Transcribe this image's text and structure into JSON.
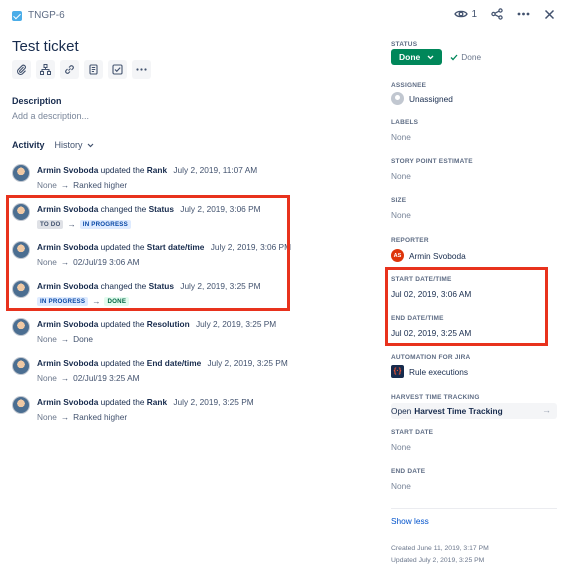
{
  "header": {
    "issue_key": "TNGP-6",
    "watch_count": "1",
    "icons": [
      "issue-type-icon",
      "eye-icon",
      "share-icon",
      "more-icon",
      "close-icon"
    ]
  },
  "issue": {
    "title": "Test ticket",
    "description_label": "Description",
    "description_placeholder": "Add a description..."
  },
  "activity": {
    "label": "Activity",
    "filter": "History",
    "entries": [
      {
        "user": "Armin Svoboda",
        "action": "updated the",
        "field": "Rank",
        "date": "July 2, 2019, 11:07 AM",
        "from": "None",
        "to": "Ranked higher"
      },
      {
        "user": "Armin Svoboda",
        "action": "changed the",
        "field": "Status",
        "date": "July 2, 2019, 3:06 PM",
        "from": "TO DO",
        "to": "IN PROGRESS"
      },
      {
        "user": "Armin Svoboda",
        "action": "updated the",
        "field": "Start date/time",
        "date": "July 2, 2019, 3:06 PM",
        "from": "None",
        "to": "02/Jul/19 3:06 AM"
      },
      {
        "user": "Armin Svoboda",
        "action": "changed the",
        "field": "Status",
        "date": "July 2, 2019, 3:25 PM",
        "from": "IN PROGRESS",
        "to": "DONE"
      },
      {
        "user": "Armin Svoboda",
        "action": "updated the",
        "field": "Resolution",
        "date": "July 2, 2019, 3:25 PM",
        "from": "None",
        "to": "Done"
      },
      {
        "user": "Armin Svoboda",
        "action": "updated the",
        "field": "End date/time",
        "date": "July 2, 2019, 3:25 PM",
        "from": "None",
        "to": "02/Jul/19 3:25 AM"
      },
      {
        "user": "Armin Svoboda",
        "action": "updated the",
        "field": "Rank",
        "date": "July 2, 2019, 3:25 PM",
        "from": "None",
        "to": "Ranked higher"
      }
    ]
  },
  "sidebar": {
    "status_label": "STATUS",
    "status_value": "Done",
    "status_done_text": "Done",
    "assignee_label": "ASSIGNEE",
    "assignee_value": "Unassigned",
    "labels_label": "LABELS",
    "labels_value": "None",
    "story_points_label": "STORY POINT ESTIMATE",
    "story_points_value": "None",
    "size_label": "SIZE",
    "size_value": "None",
    "reporter_label": "REPORTER",
    "reporter_initials": "AS",
    "reporter_value": "Armin Svoboda",
    "start_datetime_label": "START DATE/TIME",
    "start_datetime_value": "Jul 02, 2019, 3:06 AM",
    "end_datetime_label": "END DATE/TIME",
    "end_datetime_value": "Jul 02, 2019, 3:25 AM",
    "automation_label": "AUTOMATION FOR JIRA",
    "automation_value": "Rule executions",
    "harvest_label": "HARVEST TIME TRACKING",
    "harvest_prefix": "Open",
    "harvest_name": "Harvest Time Tracking",
    "start_date_label": "START DATE",
    "start_date_value": "None",
    "end_date_label": "END DATE",
    "end_date_value": "None",
    "show_less": "Show less",
    "created": "Created June 11, 2019, 3:17 PM",
    "updated": "Updated July 2, 2019, 3:25 PM"
  },
  "colors": {
    "highlight": "#e8321d",
    "status_green": "#00875a",
    "link_blue": "#0052cc"
  }
}
